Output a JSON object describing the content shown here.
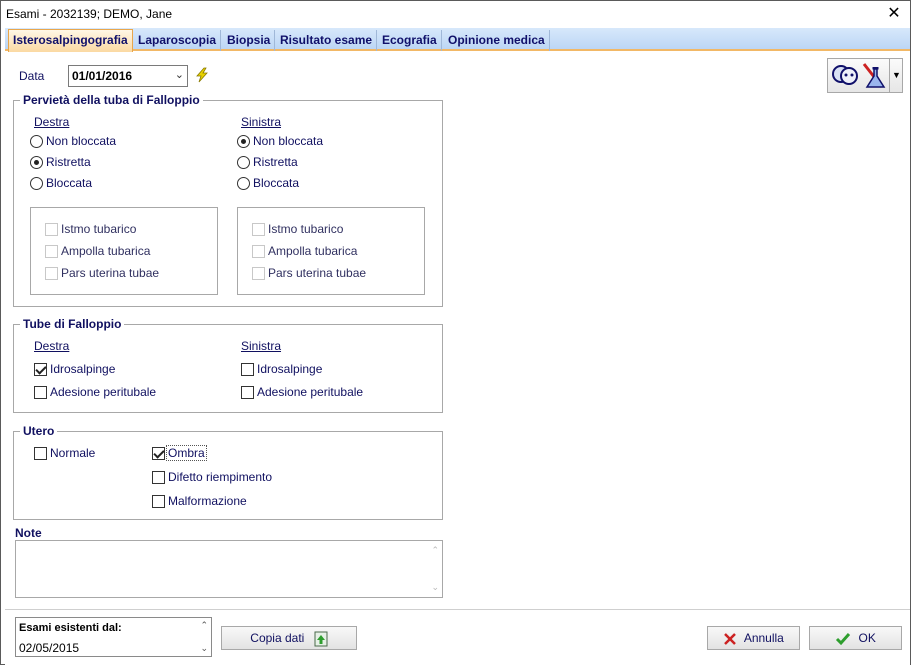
{
  "window": {
    "title": "Esami - 2032139; DEMO, Jane",
    "close_glyph": "✕"
  },
  "tabs": [
    {
      "label": "Isterosalpingografia",
      "active": true
    },
    {
      "label": "Laparoscopia",
      "active": false
    },
    {
      "label": "Biopsia",
      "active": false
    },
    {
      "label": "Risultato esame",
      "active": false
    },
    {
      "label": "Ecografia",
      "active": false
    },
    {
      "label": "Opinione medica",
      "active": false
    }
  ],
  "date": {
    "label": "Data",
    "value": "01/01/2016"
  },
  "patency": {
    "title": "Pervietà della tuba di Falloppio",
    "right": {
      "heading": "Destra",
      "options": [
        "Non bloccata",
        "Ristretta",
        "Bloccata"
      ],
      "selected": "Ristretta",
      "checks": [
        "Istmo tubarico",
        "Ampolla tubarica",
        "Pars uterina tubae"
      ]
    },
    "left": {
      "heading": "Sinistra",
      "options": [
        "Non bloccata",
        "Ristretta",
        "Bloccata"
      ],
      "selected": "Non bloccata",
      "checks": [
        "Istmo tubarico",
        "Ampolla tubarica",
        "Pars uterina tubae"
      ]
    }
  },
  "tubes": {
    "title": "Tube di Falloppio",
    "right": {
      "heading": "Destra",
      "items": [
        {
          "label": "Idrosalpinge",
          "checked": true
        },
        {
          "label": "Adesione peritubale",
          "checked": false
        }
      ]
    },
    "left": {
      "heading": "Sinistra",
      "items": [
        {
          "label": "Idrosalpinge",
          "checked": false
        },
        {
          "label": "Adesione peritubale",
          "checked": false
        }
      ]
    }
  },
  "uterus": {
    "title": "Utero",
    "items": [
      {
        "label": "Normale",
        "checked": false
      },
      {
        "label": "Ombra",
        "checked": true
      },
      {
        "label": "Difetto riempimento",
        "checked": false
      },
      {
        "label": "Malformazione",
        "checked": false
      }
    ]
  },
  "note": {
    "label": "Note",
    "value": ""
  },
  "footer": {
    "existing_label": "Esami esistenti dal:",
    "existing_value": "02/05/2015",
    "copy_label": "Copia dati",
    "cancel_label": "Annulla",
    "ok_label": "OK"
  },
  "colors": {
    "accent_tab": "#fbd9a2",
    "tab_bar": "#bcd6f5",
    "text": "#101060",
    "ok_green": "#2e9e2e",
    "cancel_red": "#cc2222"
  }
}
